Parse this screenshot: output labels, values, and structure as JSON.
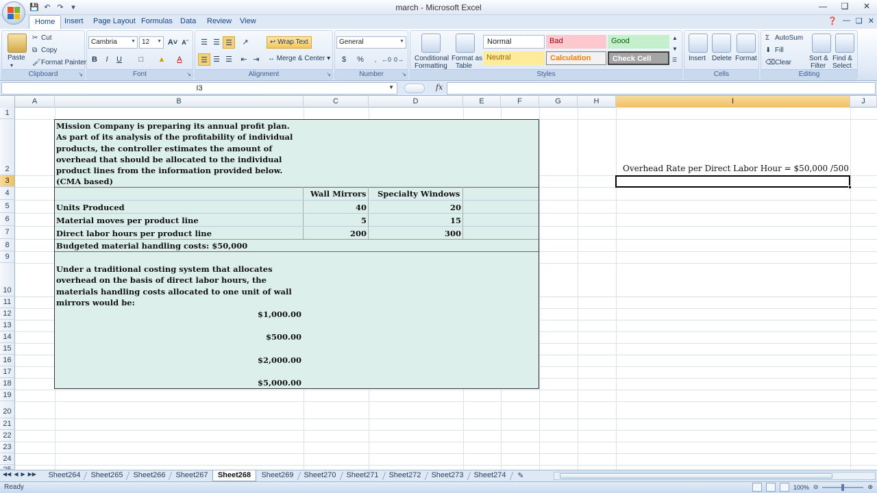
{
  "window": {
    "title": "march - Microsoft Excel"
  },
  "ribbon": {
    "tabs": [
      "Home",
      "Insert",
      "Page Layout",
      "Formulas",
      "Data",
      "Review",
      "View"
    ],
    "clipboard": {
      "label": "Clipboard",
      "paste": "Paste",
      "cut": "Cut",
      "copy": "Copy",
      "format_painter": "Format Painter"
    },
    "font": {
      "label": "Font",
      "name": "Cambria",
      "size": "12"
    },
    "alignment": {
      "label": "Alignment",
      "wrap_text": "Wrap Text",
      "merge_center": "Merge & Center"
    },
    "number": {
      "label": "Number",
      "format": "General",
      "currency": "$",
      "percent": "%"
    },
    "styles": {
      "label": "Styles",
      "conditional_formatting": "Conditional",
      "conditional_formatting_2": "Formatting",
      "format_as_table": "Format as",
      "format_as_table_2": "Table",
      "normal": "Normal",
      "bad": "Bad",
      "good": "Good",
      "neutral": "Neutral",
      "calculation": "Calculation",
      "check_cell": "Check Cell"
    },
    "cells": {
      "label": "Cells",
      "insert": "Insert",
      "delete": "Delete",
      "format": "Format"
    },
    "editing": {
      "label": "Editing",
      "autosum": "AutoSum",
      "fill": "Fill",
      "clear": "Clear",
      "sort_filter": "Sort &",
      "sort_filter_2": "Filter",
      "find_select": "Find &",
      "find_select_2": "Select"
    }
  },
  "formula_bar": {
    "name_box": "I3",
    "fx": "fx",
    "value": ""
  },
  "grid": {
    "columns": [
      "A",
      "B",
      "C",
      "D",
      "E",
      "F",
      "G",
      "H",
      "I",
      "J"
    ],
    "rows": [
      "1",
      "2",
      "3",
      "4",
      "5",
      "6",
      "7",
      "8",
      "9",
      "10",
      "11",
      "12",
      "13",
      "14",
      "15",
      "16",
      "17",
      "18",
      "19",
      "20",
      "21",
      "22",
      "23",
      "24",
      "25"
    ],
    "problem_text": "Mission Company is preparing its annual profit plan. As part of its analysis of the profitability of individual products, the controller estimates the amount of overhead that should be allocated to the individual product lines from the information provided below. (CMA based)",
    "table": {
      "col_c_header": "Wall Mirrors",
      "col_d_header": "Specialty Windows",
      "rows": [
        {
          "label": "Units Produced",
          "c": "40",
          "d": "20"
        },
        {
          "label": "Material moves per product line",
          "c": "5",
          "d": "15"
        },
        {
          "label": "Direct labor hours per product line",
          "c": "200",
          "d": "300"
        }
      ],
      "budgeted": "Budgeted material handling costs: $50,000"
    },
    "question": "Under a traditional costing system that allocates overhead on the basis of direct labor hours, the materials handling costs allocated to one unit of wall mirrors would be:",
    "options": [
      "$1,000.00",
      "$500.00",
      "$2,000.00",
      "$5,000.00"
    ],
    "i2_text": "Overhead Rate per Direct Labor Hour = $50,000 /500"
  },
  "sheets": {
    "tabs": [
      "Sheet264",
      "Sheet265",
      "Sheet266",
      "Sheet267",
      "Sheet268",
      "Sheet269",
      "Sheet270",
      "Sheet271",
      "Sheet272",
      "Sheet273",
      "Sheet274"
    ],
    "active": "Sheet268"
  },
  "status": {
    "text": "Ready",
    "zoom": "100%"
  },
  "colors": {
    "problem_fill": "#dcefea",
    "selected_header": "#f1c15f",
    "ribbon_blue": "#dfe8f5"
  }
}
